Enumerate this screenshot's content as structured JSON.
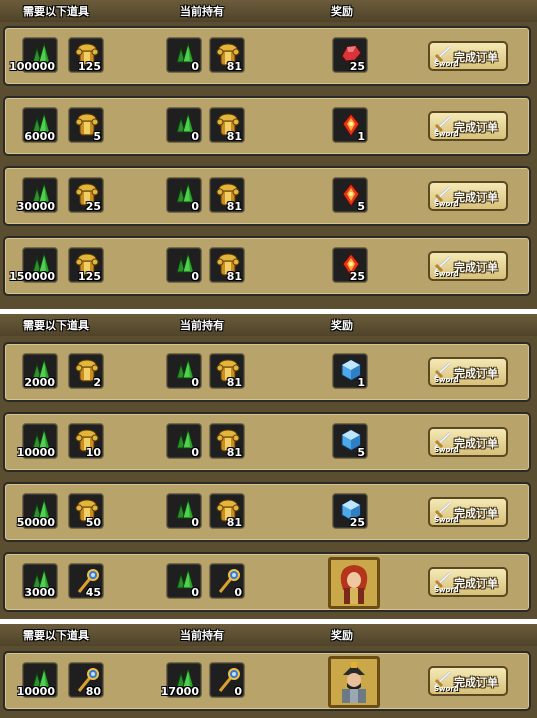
{
  "headers": {
    "required": "需要以下道具",
    "owned": "当前持有",
    "reward": "奖励"
  },
  "button": {
    "label": "完成订单",
    "sub": "Sword"
  },
  "colors": {
    "panel": "#b8a36b",
    "section_bg": "#5a4d30",
    "slot_bg": "#1f1f1f"
  },
  "sections": [
    {
      "orders": [
        {
          "req": [
            {
              "icon": "green-crystal-icon",
              "count": "100000"
            },
            {
              "icon": "gold-armor-icon",
              "count": "125"
            }
          ],
          "have": [
            {
              "icon": "green-crystal-icon",
              "count": "0"
            },
            {
              "icon": "gold-armor-icon",
              "count": "81"
            }
          ],
          "reward": {
            "icon": "red-ore-icon",
            "count": "25"
          }
        },
        {
          "req": [
            {
              "icon": "green-crystal-icon",
              "count": "6000"
            },
            {
              "icon": "gold-armor-icon",
              "count": "5"
            }
          ],
          "have": [
            {
              "icon": "green-crystal-icon",
              "count": "0"
            },
            {
              "icon": "gold-armor-icon",
              "count": "81"
            }
          ],
          "reward": {
            "icon": "fire-gem-icon",
            "count": "1"
          }
        },
        {
          "req": [
            {
              "icon": "green-crystal-icon",
              "count": "30000"
            },
            {
              "icon": "gold-armor-icon",
              "count": "25"
            }
          ],
          "have": [
            {
              "icon": "green-crystal-icon",
              "count": "0"
            },
            {
              "icon": "gold-armor-icon",
              "count": "81"
            }
          ],
          "reward": {
            "icon": "fire-gem-icon",
            "count": "5"
          }
        },
        {
          "req": [
            {
              "icon": "green-crystal-icon",
              "count": "150000"
            },
            {
              "icon": "gold-armor-icon",
              "count": "125"
            }
          ],
          "have": [
            {
              "icon": "green-crystal-icon",
              "count": "0"
            },
            {
              "icon": "gold-armor-icon",
              "count": "81"
            }
          ],
          "reward": {
            "icon": "fire-gem-icon",
            "count": "25"
          }
        }
      ]
    },
    {
      "orders": [
        {
          "req": [
            {
              "icon": "green-crystal-icon",
              "count": "2000"
            },
            {
              "icon": "gold-armor-icon",
              "count": "2"
            }
          ],
          "have": [
            {
              "icon": "green-crystal-icon",
              "count": "0"
            },
            {
              "icon": "gold-armor-icon",
              "count": "81"
            }
          ],
          "reward": {
            "icon": "ice-crystal-icon",
            "count": "1"
          }
        },
        {
          "req": [
            {
              "icon": "green-crystal-icon",
              "count": "10000"
            },
            {
              "icon": "gold-armor-icon",
              "count": "10"
            }
          ],
          "have": [
            {
              "icon": "green-crystal-icon",
              "count": "0"
            },
            {
              "icon": "gold-armor-icon",
              "count": "81"
            }
          ],
          "reward": {
            "icon": "ice-crystal-icon",
            "count": "5"
          }
        },
        {
          "req": [
            {
              "icon": "green-crystal-icon",
              "count": "50000"
            },
            {
              "icon": "gold-armor-icon",
              "count": "50"
            }
          ],
          "have": [
            {
              "icon": "green-crystal-icon",
              "count": "0"
            },
            {
              "icon": "gold-armor-icon",
              "count": "81"
            }
          ],
          "reward": {
            "icon": "ice-crystal-icon",
            "count": "25"
          }
        },
        {
          "req": [
            {
              "icon": "green-crystal-icon",
              "count": "3000"
            },
            {
              "icon": "scepter-icon",
              "count": "45"
            }
          ],
          "have": [
            {
              "icon": "green-crystal-icon",
              "count": "0"
            },
            {
              "icon": "scepter-icon",
              "count": "0"
            }
          ],
          "reward": {
            "icon": "red-hair-warrior-portrait",
            "count": ""
          }
        }
      ]
    },
    {
      "orders": [
        {
          "req": [
            {
              "icon": "green-crystal-icon",
              "count": "10000"
            },
            {
              "icon": "scepter-icon",
              "count": "80"
            }
          ],
          "have": [
            {
              "icon": "green-crystal-icon",
              "count": "17000"
            },
            {
              "icon": "scepter-icon",
              "count": "0"
            }
          ],
          "reward": {
            "icon": "armored-general-portrait",
            "count": ""
          }
        }
      ]
    }
  ]
}
